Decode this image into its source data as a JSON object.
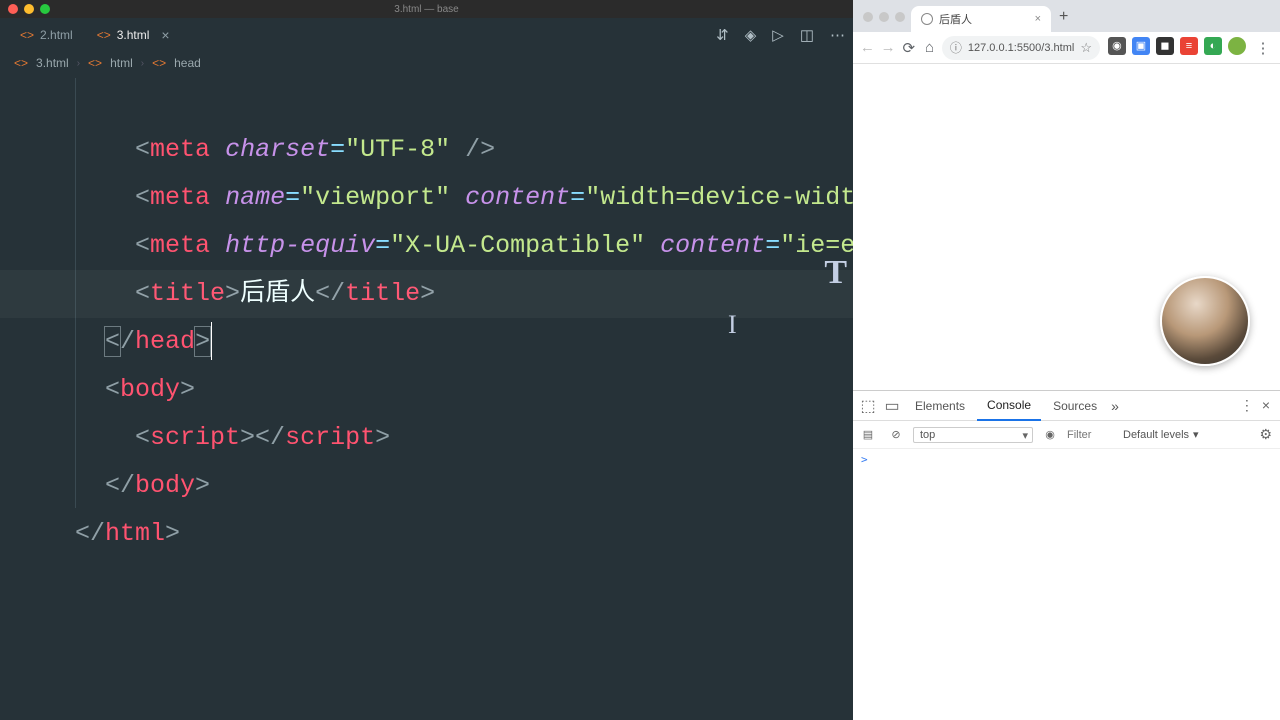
{
  "editor": {
    "windowTitle": "3.html — base",
    "tabs": [
      {
        "label": "2.html",
        "active": false
      },
      {
        "label": "3.html",
        "active": true
      }
    ],
    "breadcrumb": {
      "file": "3.html",
      "path1": "html",
      "path2": "head"
    },
    "code": {
      "l1_tag": "meta",
      "l1_attr": "charset",
      "l1_val": "\"UTF-8\"",
      "l2_tag": "meta",
      "l2_attr1": "name",
      "l2_val1": "\"viewport\"",
      "l2_attr2": "content",
      "l2_val2": "\"width=device-width",
      "l3_tag": "meta",
      "l3_attr1": "http-equiv",
      "l3_val1": "\"X-UA-Compatible\"",
      "l3_attr2": "content",
      "l3_val2": "\"ie=ed",
      "l4_open": "title",
      "l4_text": "后盾人",
      "l4_close": "title",
      "l5_close": "head",
      "l6_open": "body",
      "l7_open": "script",
      "l7_close": "script",
      "l8_close": "body",
      "l9_close": "html"
    }
  },
  "browser": {
    "tab": {
      "title": "后盾人"
    },
    "url": "127.0.0.1:5500/3.html",
    "devtools": {
      "tabs": {
        "elements": "Elements",
        "console": "Console",
        "sources": "Sources"
      },
      "context": "top",
      "filter": "Filter",
      "levels": "Default levels",
      "prompt": ">"
    }
  }
}
